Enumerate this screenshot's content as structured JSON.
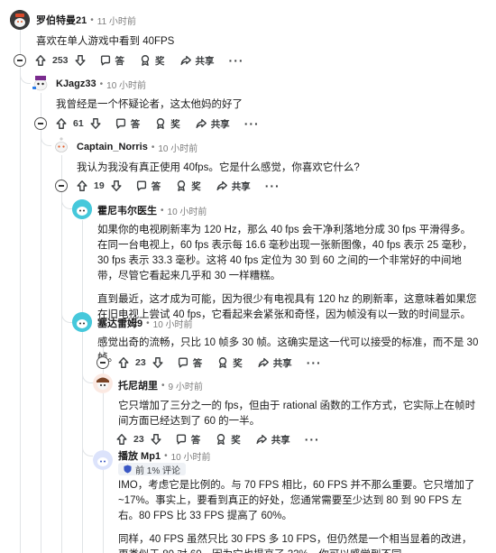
{
  "comments": [
    {
      "author": "罗伯特曼21",
      "time": "11 小时前",
      "paragraphs": [
        "喜欢在单人游戏中看到 40FPS"
      ],
      "votes": "253",
      "avatar_icon": "snoo-avatar-icon"
    },
    {
      "author": "KJagz33",
      "time": "10 小时前",
      "paragraphs": [
        "我曾经是一个怀疑论者，这太他妈的好了"
      ],
      "votes": "61",
      "avatar_icon": "snoo-avatar-icon"
    },
    {
      "author": "Captain_Norris",
      "time": "10 小时前",
      "paragraphs": [
        "我认为我没有真正使用 40fps。它是什么感觉，你喜欢它什么?"
      ],
      "votes": "19",
      "avatar_icon": "snoo-avatar-icon"
    },
    {
      "author": "霍尼韦尔医生",
      "time": "10 小时前",
      "paragraphs": [
        "如果你的电视刷新率为 120 Hz，那么 40 fps 会干净利落地分成 30 fps 平滑得多。在同一台电视上，60 fps 表示每 16.6 毫秒出现一张新图像，40 fps 表示 25 毫秒，30 fps 表示 33.3 毫秒。这将 40 fps 定位为 30 到 60 之间的一个非常好的中间地带，尽管它看起来几乎和 30 一样糟糕。",
        "直到最近，这才成为可能，因为很少有电视具有 120 hz 的刷新率，这意味着如果您在旧电视上尝试 40 fps，它看起来会紧张和奇怪，因为帧没有以一致的时间显示。"
      ],
      "votes": "",
      "avatar_icon": "snoo-avatar-icon"
    },
    {
      "author": "塞达雷姆9",
      "time": "10 小时前",
      "paragraphs": [
        "感觉出奇的流畅，只比 10 帧多 30 帧。这确实是这一代可以接受的标准，而不是 30 帧。"
      ],
      "votes": "23",
      "avatar_icon": "snoo-avatar-icon"
    },
    {
      "author": "托尼胡里",
      "time": "9 小时前",
      "paragraphs": [
        "它只增加了三分之一的 fps，但由于 rational 函数的工作方式，它实际上在帧时间方面已经达到了 60 的一半。"
      ],
      "votes": "23",
      "avatar_icon": "snoo-avatar-icon"
    },
    {
      "author": "播放 Mp1",
      "time": "10 小时前",
      "badge": "前 1% 评论",
      "paragraphs": [
        "IMO，考虑它是比例的。与 70 FPS 相比，60 FPS 并不那么重要。它只增加了 ~17%。事实上，要看到真正的好处，您通常需要至少达到 80 到 90 FPS 左右。80 FPS 比 33 FPS 提高了 60%。",
        "同样，40 FPS 虽然只比 30 FPS 多 10 FPS，但仍然是一个相当显着的改进，更类似于 80 对 60，因为它也提高了 33%。你可以感觉到不同。"
      ],
      "votes": "",
      "avatar_icon": "snoo-avatar-icon"
    }
  ],
  "actions": {
    "reply": "答",
    "award": "奖",
    "share": "共享",
    "more": "···"
  },
  "icons": [
    "upvote-icon",
    "downvote-icon",
    "reply-icon",
    "award-icon",
    "share-icon",
    "collapse-icon",
    "shield-icon"
  ],
  "colors": {
    "text": "#1a1a1b",
    "meta": "#7c7c7c",
    "thread_line": "#e0e3e6",
    "badge_bg": "#eef1f5"
  }
}
